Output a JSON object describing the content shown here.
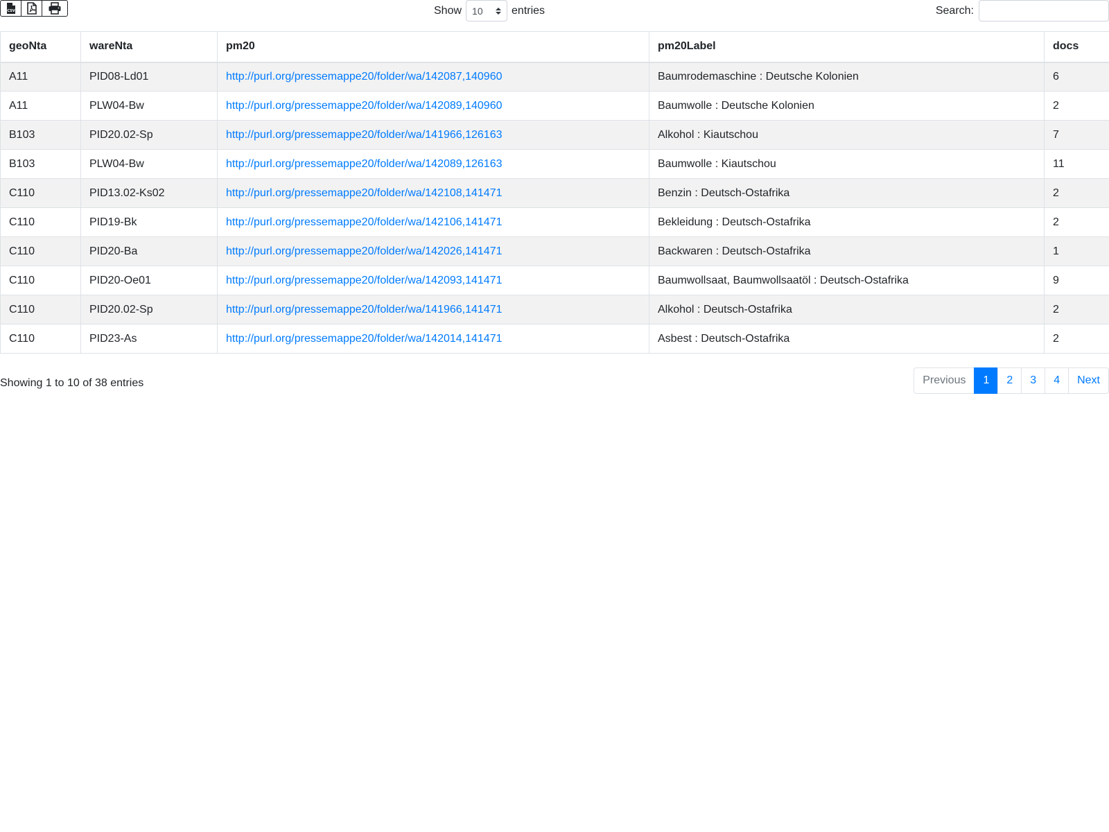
{
  "toolbar": {
    "export_buttons": [
      {
        "icon": "csv-file-icon",
        "badge": "CSV"
      },
      {
        "icon": "pdf-file-icon"
      },
      {
        "icon": "printer-icon"
      }
    ],
    "length_prefix": "Show",
    "length_value": "10",
    "length_suffix": "entries",
    "search_label": "Search:",
    "search_value": ""
  },
  "table": {
    "columns": [
      "geoNta",
      "wareNta",
      "pm20",
      "pm20Label",
      "docs"
    ],
    "rows": [
      {
        "geoNta": "A11",
        "wareNta": "PID08-Ld01",
        "pm20": "http://purl.org/pressemappe20/folder/wa/142087,140960",
        "pm20Label": "Baumrodemaschine : Deutsche Kolonien",
        "docs": "6"
      },
      {
        "geoNta": "A11",
        "wareNta": "PLW04-Bw",
        "pm20": "http://purl.org/pressemappe20/folder/wa/142089,140960",
        "pm20Label": "Baumwolle : Deutsche Kolonien",
        "docs": "2"
      },
      {
        "geoNta": "B103",
        "wareNta": "PID20.02-Sp",
        "pm20": "http://purl.org/pressemappe20/folder/wa/141966,126163",
        "pm20Label": "Alkohol : Kiautschou",
        "docs": "7"
      },
      {
        "geoNta": "B103",
        "wareNta": "PLW04-Bw",
        "pm20": "http://purl.org/pressemappe20/folder/wa/142089,126163",
        "pm20Label": "Baumwolle : Kiautschou",
        "docs": "11"
      },
      {
        "geoNta": "C110",
        "wareNta": "PID13.02-Ks02",
        "pm20": "http://purl.org/pressemappe20/folder/wa/142108,141471",
        "pm20Label": "Benzin : Deutsch-Ostafrika",
        "docs": "2"
      },
      {
        "geoNta": "C110",
        "wareNta": "PID19-Bk",
        "pm20": "http://purl.org/pressemappe20/folder/wa/142106,141471",
        "pm20Label": "Bekleidung : Deutsch-Ostafrika",
        "docs": "2"
      },
      {
        "geoNta": "C110",
        "wareNta": "PID20-Ba",
        "pm20": "http://purl.org/pressemappe20/folder/wa/142026,141471",
        "pm20Label": "Backwaren : Deutsch-Ostafrika",
        "docs": "1"
      },
      {
        "geoNta": "C110",
        "wareNta": "PID20-Oe01",
        "pm20": "http://purl.org/pressemappe20/folder/wa/142093,141471",
        "pm20Label": "Baumwollsaat, Baumwollsaatöl : Deutsch-Ostafrika",
        "docs": "9"
      },
      {
        "geoNta": "C110",
        "wareNta": "PID20.02-Sp",
        "pm20": "http://purl.org/pressemappe20/folder/wa/141966,141471",
        "pm20Label": "Alkohol : Deutsch-Ostafrika",
        "docs": "2"
      },
      {
        "geoNta": "C110",
        "wareNta": "PID23-As",
        "pm20": "http://purl.org/pressemappe20/folder/wa/142014,141471",
        "pm20Label": "Asbest : Deutsch-Ostafrika",
        "docs": "2"
      }
    ]
  },
  "footer": {
    "info": "Showing 1 to 10 of 38 entries",
    "pagination": {
      "previous": "Previous",
      "pages": [
        "1",
        "2",
        "3",
        "4"
      ],
      "active_page": "1",
      "next": "Next"
    }
  },
  "colors": {
    "link": "#007bff",
    "active_page_bg": "#007bff",
    "stripe": "#f2f2f2",
    "border": "#dee2e6"
  }
}
